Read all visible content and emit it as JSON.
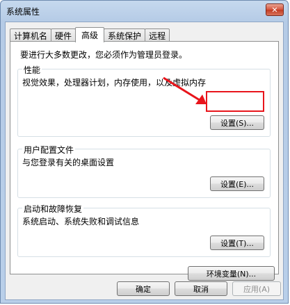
{
  "window": {
    "title": "系统属性",
    "close_label": "✕"
  },
  "tabs": [
    {
      "label": "计算机名",
      "active": false
    },
    {
      "label": "硬件",
      "active": false
    },
    {
      "label": "高级",
      "active": true
    },
    {
      "label": "系统保护",
      "active": false
    },
    {
      "label": "远程",
      "active": false
    }
  ],
  "intro": "要进行大多数更改，您必须作为管理员登录。",
  "performance": {
    "title": "性能",
    "desc": "视觉效果，处理器计划，内存使用，以及虚拟内存",
    "button": "设置(S)..."
  },
  "profile": {
    "title": "用户配置文件",
    "desc": "与您登录有关的桌面设置",
    "button": "设置(E)..."
  },
  "startup": {
    "title": "启动和故障恢复",
    "desc": "系统启动、系统失败和调试信息",
    "button": "设置(T)..."
  },
  "env_button": "环境变量(N)...",
  "footer": {
    "ok": "确定",
    "cancel": "取消",
    "apply": "应用(A)"
  },
  "colors": {
    "annotation": "#e8141b"
  }
}
